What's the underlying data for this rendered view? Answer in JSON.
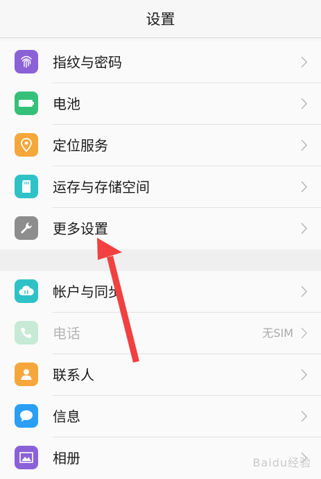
{
  "header": {
    "title": "设置"
  },
  "group1": [
    {
      "label": "指纹与密码",
      "icon": "fingerprint-icon",
      "color": "#8b61d8"
    },
    {
      "label": "电池",
      "icon": "battery-icon",
      "color": "#35c07a"
    },
    {
      "label": "定位服务",
      "icon": "location-pin-icon",
      "color": "#f6a73b"
    },
    {
      "label": "运存与存储空间",
      "icon": "sd-card-icon",
      "color": "#2ec2c7"
    },
    {
      "label": "更多设置",
      "icon": "wrench-icon",
      "color": "#8d8d8d"
    }
  ],
  "group2": [
    {
      "label": "帐户与同步",
      "icon": "cloud-sync-icon",
      "color": "#2ec2c7"
    },
    {
      "label": "电话",
      "icon": "phone-icon",
      "color": "#c6ead5",
      "value": "无SIM"
    },
    {
      "label": "联系人",
      "icon": "contact-icon",
      "color": "#f6a73b"
    },
    {
      "label": "信息",
      "icon": "message-icon",
      "color": "#2a9ff5"
    },
    {
      "label": "相册",
      "icon": "photo-album-icon",
      "color": "#8b61d8"
    }
  ],
  "watermark": "Baidu经验",
  "colors": {
    "annotation_arrow": "#f24040"
  }
}
